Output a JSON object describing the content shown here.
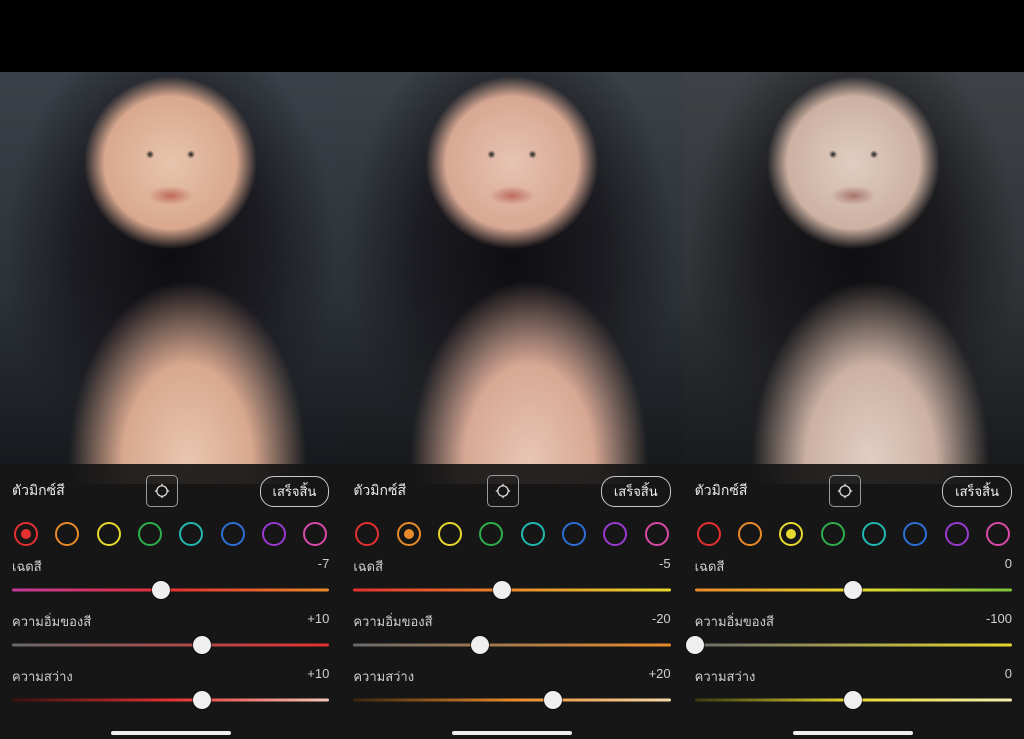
{
  "labels": {
    "title": "ตัวมิกซ์สี",
    "done": "เสร็จสิ้น",
    "hue": "เฉดสี",
    "saturation": "ความอิ่มของสี",
    "luminance": "ความสว่าง"
  },
  "swatches": [
    {
      "name": "red",
      "color": "#e43030"
    },
    {
      "name": "orange",
      "color": "#e98a2a"
    },
    {
      "name": "yellow",
      "color": "#e7d92f"
    },
    {
      "name": "green",
      "color": "#2fae4d"
    },
    {
      "name": "aqua",
      "color": "#22b8b0"
    },
    {
      "name": "blue",
      "color": "#2e6fd6"
    },
    {
      "name": "purple",
      "color": "#9a3ad0"
    },
    {
      "name": "magenta",
      "color": "#d84aa8"
    }
  ],
  "panels": [
    {
      "selected": 0,
      "hue": {
        "value": "-7",
        "pos": 47,
        "gradient": "linear-gradient(90deg,#c23a9b,#e43030,#e98a2a)"
      },
      "saturation": {
        "value": "+10",
        "pos": 60,
        "gradient": "linear-gradient(90deg,#6a6a6a,#e43030)"
      },
      "luminance": {
        "value": "+10",
        "pos": 60,
        "gradient": "linear-gradient(90deg,#3a1010,#e43030,#f7c7b8)"
      }
    },
    {
      "selected": 1,
      "hue": {
        "value": "-5",
        "pos": 47,
        "gradient": "linear-gradient(90deg,#e43030,#e98a2a,#e7d92f)"
      },
      "saturation": {
        "value": "-20",
        "pos": 40,
        "gradient": "linear-gradient(90deg,#6a6a6a,#e98a2a)"
      },
      "luminance": {
        "value": "+20",
        "pos": 63,
        "gradient": "linear-gradient(90deg,#3a2510,#e98a2a,#f6d7a8)"
      }
    },
    {
      "selected": 2,
      "hue": {
        "value": "0",
        "pos": 50,
        "gradient": "linear-gradient(90deg,#e98a2a,#e7d92f,#7bc23a)"
      },
      "saturation": {
        "value": "-100",
        "pos": 0,
        "gradient": "linear-gradient(90deg,#6a6a6a,#e7d92f)"
      },
      "luminance": {
        "value": "0",
        "pos": 50,
        "gradient": "linear-gradient(90deg,#3a3a10,#e7d92f,#f3efb0)"
      }
    }
  ]
}
